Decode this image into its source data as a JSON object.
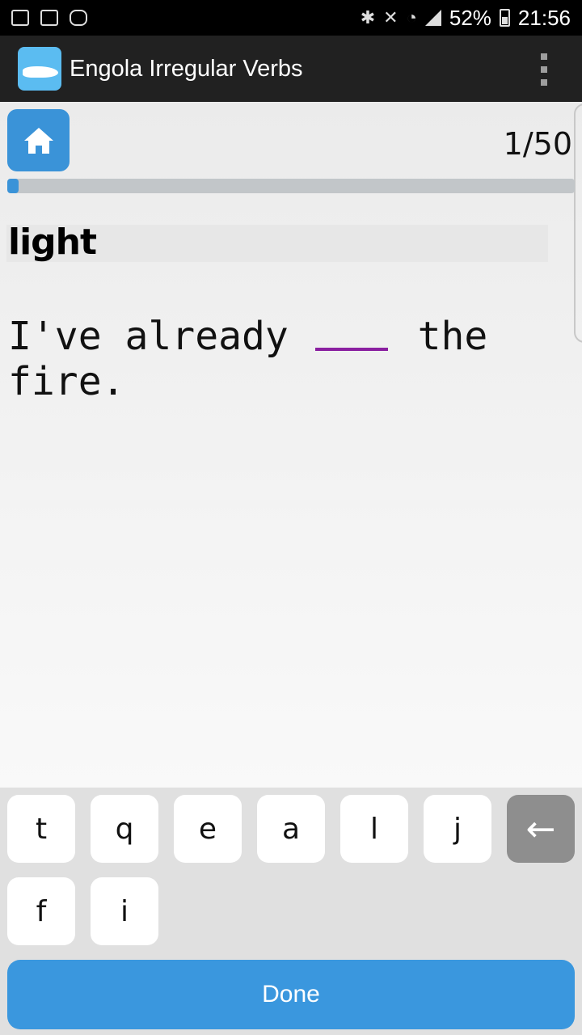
{
  "status_bar": {
    "battery": "52%",
    "time": "21:56",
    "icons": [
      "gmail-icon",
      "gallery-icon",
      "app-notification-icon",
      "bluetooth-icon",
      "mute-icon",
      "wifi-icon",
      "signal-icon",
      "battery-icon"
    ]
  },
  "app_bar": {
    "title": "Engola Irregular Verbs",
    "menu_icon": "overflow-menu-icon"
  },
  "quiz": {
    "counter": "1/50",
    "progress_fraction": 0.02,
    "verb": "light",
    "sentence_before": "I've already",
    "sentence_after": "the fire."
  },
  "keyboard": {
    "keys_row1": [
      "t",
      "q",
      "e",
      "a",
      "l",
      "j"
    ],
    "backspace_label": "←",
    "keys_row2": [
      "f",
      "i"
    ],
    "done_label": "Done"
  },
  "colors": {
    "accent": "#3a93d8",
    "blank_underline": "#8a1fa0",
    "app_bar": "#212121"
  }
}
